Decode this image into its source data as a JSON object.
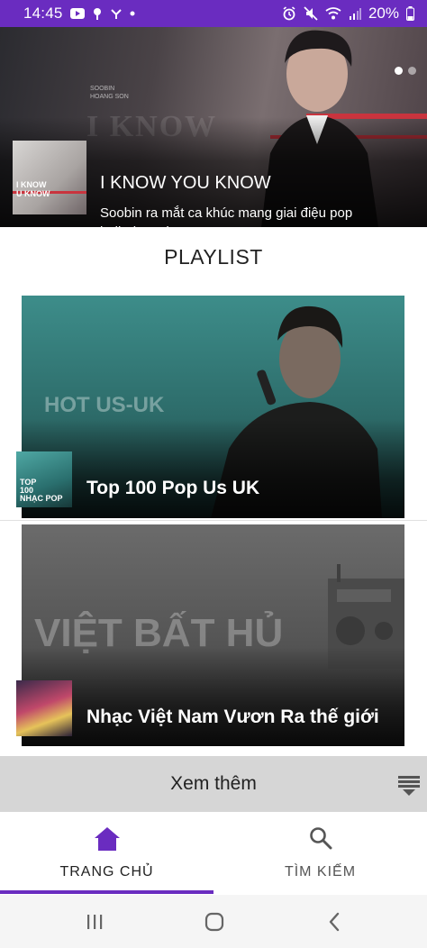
{
  "status_bar": {
    "time": "14:45",
    "battery": "20%",
    "icons_left": [
      "youtube-icon",
      "notification-icon",
      "network-icon",
      "dot-icon"
    ],
    "icons_right": [
      "alarm-icon",
      "mute-icon",
      "wifi-icon",
      "signal-icon",
      "battery-icon"
    ]
  },
  "banner": {
    "title": "I KNOW YOU KNOW",
    "subtitle": "Soobin ra mắt ca khúc mang giai điệu pop ballad cực hay",
    "artist_tag": "SOOBIN\nHOANG SON",
    "background_text": "I KNOW",
    "thumb_text": "I KNOW\nU KNOW",
    "active_page": 1,
    "page_count": 2
  },
  "playlist": {
    "heading": "PLAYLIST",
    "items": [
      {
        "title": "Top 100 Pop Us UK",
        "background_text": "HOT US-UK",
        "thumb_text": "TOP\n100\nNHẠC POP"
      },
      {
        "title": "Nhạc Việt Nam Vươn Ra thế giới",
        "background_text": "VIỆT BẤT HỦ",
        "thumb_text": ""
      }
    ]
  },
  "see_more": {
    "label": "Xem thêm"
  },
  "bottom_nav": {
    "items": [
      {
        "label": "TRANG CHỦ",
        "icon": "home-icon",
        "active": true
      },
      {
        "label": "TÌM KIẾM",
        "icon": "search-icon",
        "active": false
      }
    ]
  },
  "colors": {
    "accent": "#6a2cc0",
    "see_more_bg": "#d6d6d6"
  }
}
